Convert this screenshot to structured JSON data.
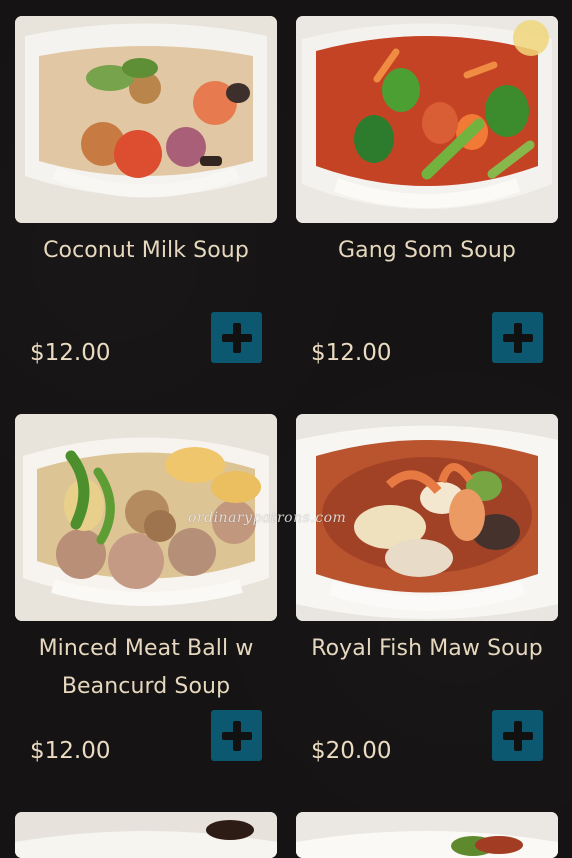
{
  "menu": {
    "items": [
      {
        "name": "Coconut Milk Soup",
        "price": "$12.00",
        "image_icon": "coconut-milk-soup-photo"
      },
      {
        "name": "Gang Som Soup",
        "price": "$12.00",
        "image_icon": "gang-som-soup-photo"
      },
      {
        "name": "Minced Meat Ball w Beancurd Soup",
        "price": "$12.00",
        "image_icon": "minced-meatball-soup-photo"
      },
      {
        "name": "Royal Fish Maw Soup",
        "price": "$20.00",
        "image_icon": "royal-fish-maw-soup-photo"
      },
      {
        "name": "",
        "price": "",
        "image_icon": "partial-dish-photo"
      },
      {
        "name": "",
        "price": "",
        "image_icon": "partial-dish-photo"
      }
    ]
  },
  "watermark": "ordinarypatrons.com",
  "colors": {
    "background": "#151313",
    "card_text": "#e6d8bf",
    "add_button": "#0c5871"
  },
  "icons": {
    "add_button": "plus-icon"
  }
}
